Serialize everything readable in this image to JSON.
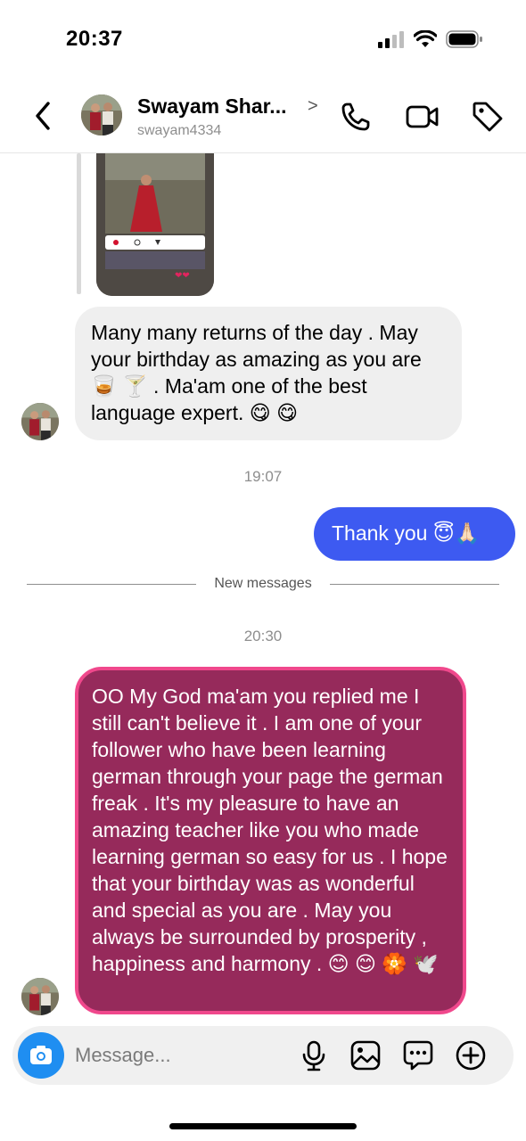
{
  "status_bar": {
    "time": "20:37"
  },
  "header": {
    "name": "Swayam Shar...",
    "username": "swayam4334",
    "chevron": ">"
  },
  "messages": {
    "received_1": "Many many returns of the day . May your birthday as amazing as you are 🥃 🍸 . Ma'am one of the best language expert. 😋 😋",
    "timestamp_1": "19:07",
    "sent_1": "Thank you 😇🙏🏻",
    "new_messages_label": "New messages",
    "timestamp_2": "20:30",
    "received_2": "OO My God ma'am you replied me I still can't believe it . I am one of your follower who have been learning german through your page the german freak . It's my pleasure to have an amazing teacher like you who made learning german so easy for us . I hope that your birthday was as wonderful and special as you are . May you always be surrounded by prosperity , happiness and harmony . 😊 😊 🏵️ 🕊️"
  },
  "composer": {
    "placeholder": "Message..."
  },
  "colors": {
    "sent_bubble": "#3d5af1",
    "received_bubble": "#efefef",
    "highlight_bubble": "#962a5b",
    "highlight_border": "#f0488c",
    "camera_button": "#1f8ef1"
  },
  "icons": {
    "header": [
      "back-arrow-icon",
      "phone-icon",
      "video-camera-icon",
      "tag-icon"
    ],
    "composer": [
      "camera-icon",
      "microphone-icon",
      "gallery-icon",
      "sticker-icon",
      "plus-icon"
    ]
  }
}
